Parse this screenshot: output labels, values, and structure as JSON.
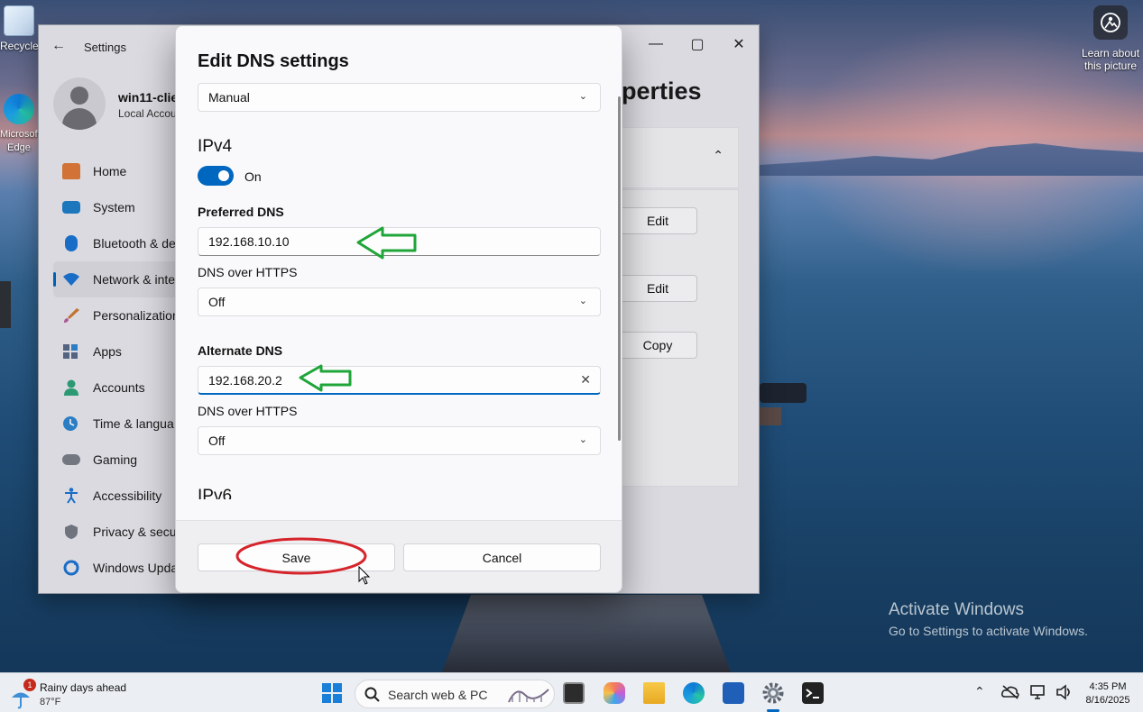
{
  "desktop": {
    "icons": [
      {
        "label": "Recycle",
        "icon": "recycle-bin-icon"
      },
      {
        "label": "Microsoft Edge",
        "icon": "edge-icon"
      }
    ],
    "learn_about": "Learn about this picture",
    "activate_title": "Activate Windows",
    "activate_sub": "Go to Settings to activate Windows."
  },
  "settings": {
    "title": "Settings",
    "user": {
      "name": "win11-clien",
      "account": "Local Accou"
    },
    "nav": [
      {
        "label": "Home",
        "icon": "home-icon",
        "color": "#e07a3a"
      },
      {
        "label": "System",
        "icon": "system-icon",
        "color": "#1f7fc8"
      },
      {
        "label": "Bluetooth & de",
        "icon": "bluetooth-icon",
        "color": "#1c74d4"
      },
      {
        "label": "Network & inte",
        "icon": "wifi-icon",
        "color": "#1c74d4",
        "active": true
      },
      {
        "label": "Personalization",
        "icon": "brush-icon",
        "color": "#d07a33"
      },
      {
        "label": "Apps",
        "icon": "apps-icon",
        "color": "#5a6a88"
      },
      {
        "label": "Accounts",
        "icon": "accounts-icon",
        "color": "#2fa37b"
      },
      {
        "label": "Time & langua",
        "icon": "time-language-icon",
        "color": "#2f86d1"
      },
      {
        "label": "Gaming",
        "icon": "gaming-icon",
        "color": "#7a7f88"
      },
      {
        "label": "Accessibility",
        "icon": "accessibility-icon",
        "color": "#1c74d4"
      },
      {
        "label": "Privacy & secu",
        "icon": "shield-icon",
        "color": "#757b85"
      },
      {
        "label": "Windows Upda",
        "icon": "windows-update-icon",
        "color": "#1c74d4"
      }
    ],
    "page_title": "perties",
    "buttons": [
      "Edit",
      "Edit",
      "Copy"
    ]
  },
  "dialog": {
    "title": "Edit DNS settings",
    "mode": "Manual",
    "ipv4_heading": "IPv4",
    "toggle_label": "On",
    "preferred_label": "Preferred DNS",
    "preferred_value": "192.168.10.10",
    "doh1_label": "DNS over HTTPS",
    "doh1_value": "Off",
    "alternate_label": "Alternate DNS",
    "alternate_value": "192.168.20.2",
    "doh2_label": "DNS over HTTPS",
    "doh2_value": "Off",
    "ipv6_heading": "IPv6",
    "save": "Save",
    "cancel": "Cancel"
  },
  "taskbar": {
    "weather_badge": "1",
    "weather_label": "Rainy days ahead",
    "weather_temp": "87°F",
    "search_placeholder": "Search web & PC",
    "time": "4:35 PM",
    "date": "8/16/2025"
  }
}
